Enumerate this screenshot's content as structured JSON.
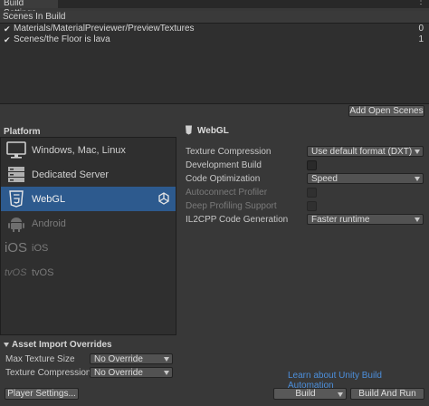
{
  "window": {
    "tab_title": "Build Settings",
    "menu_glyph": "⋮"
  },
  "scenes": {
    "header": "Scenes In Build",
    "items": [
      {
        "checked": true,
        "check_glyph": "✔",
        "name": "Materials/MaterialPreviewer/PreviewTextures",
        "index": "0"
      },
      {
        "checked": true,
        "check_glyph": "✔",
        "name": "Scenes/the Floor is lava",
        "index": "1"
      }
    ],
    "add_open_label": "Add Open Scenes"
  },
  "platform": {
    "title": "Platform",
    "items": [
      {
        "label": "Windows, Mac, Linux",
        "icon": "monitor-icon",
        "selected": false,
        "disabled": false
      },
      {
        "label": "Dedicated Server",
        "icon": "server-icon",
        "selected": false,
        "disabled": false
      },
      {
        "label": "WebGL",
        "icon": "html5-icon",
        "selected": true,
        "disabled": false
      },
      {
        "label": "Android",
        "icon": "android-icon",
        "selected": false,
        "disabled": true
      },
      {
        "label": "iOS",
        "icon": "ios-icon",
        "icon_text": "iOS",
        "selected": false,
        "disabled": true
      },
      {
        "label": "tvOS",
        "icon": "tvos-icon",
        "icon_text": "tvOS",
        "selected": false,
        "disabled": true
      }
    ],
    "selected_badge_icon": "unity-logo-icon"
  },
  "webgl": {
    "title": "WebGL",
    "settings": {
      "texture_compression": {
        "label": "Texture Compression",
        "value": "Use default format (DXT)"
      },
      "development_build": {
        "label": "Development Build",
        "checked": false
      },
      "code_optimization": {
        "label": "Code Optimization",
        "value": "Speed"
      },
      "autoconnect_profiler": {
        "label": "Autoconnect Profiler",
        "checked": false,
        "disabled": true
      },
      "deep_profiling": {
        "label": "Deep Profiling Support",
        "checked": false,
        "disabled": true
      },
      "il2cpp": {
        "label": "IL2CPP Code Generation",
        "value": "Faster runtime"
      }
    }
  },
  "asset_import": {
    "title": "Asset Import Overrides",
    "max_texture_size": {
      "label": "Max Texture Size",
      "value": "No Override"
    },
    "texture_compression": {
      "label": "Texture Compression",
      "value": "No Override"
    }
  },
  "footer": {
    "learn_link": "Learn about Unity Build Automation",
    "player_settings": "Player Settings...",
    "build": "Build",
    "build_and_run": "Build And Run"
  },
  "colors": {
    "selection": "#2d5a8e",
    "link": "#4c8fdc",
    "background": "#383838"
  }
}
